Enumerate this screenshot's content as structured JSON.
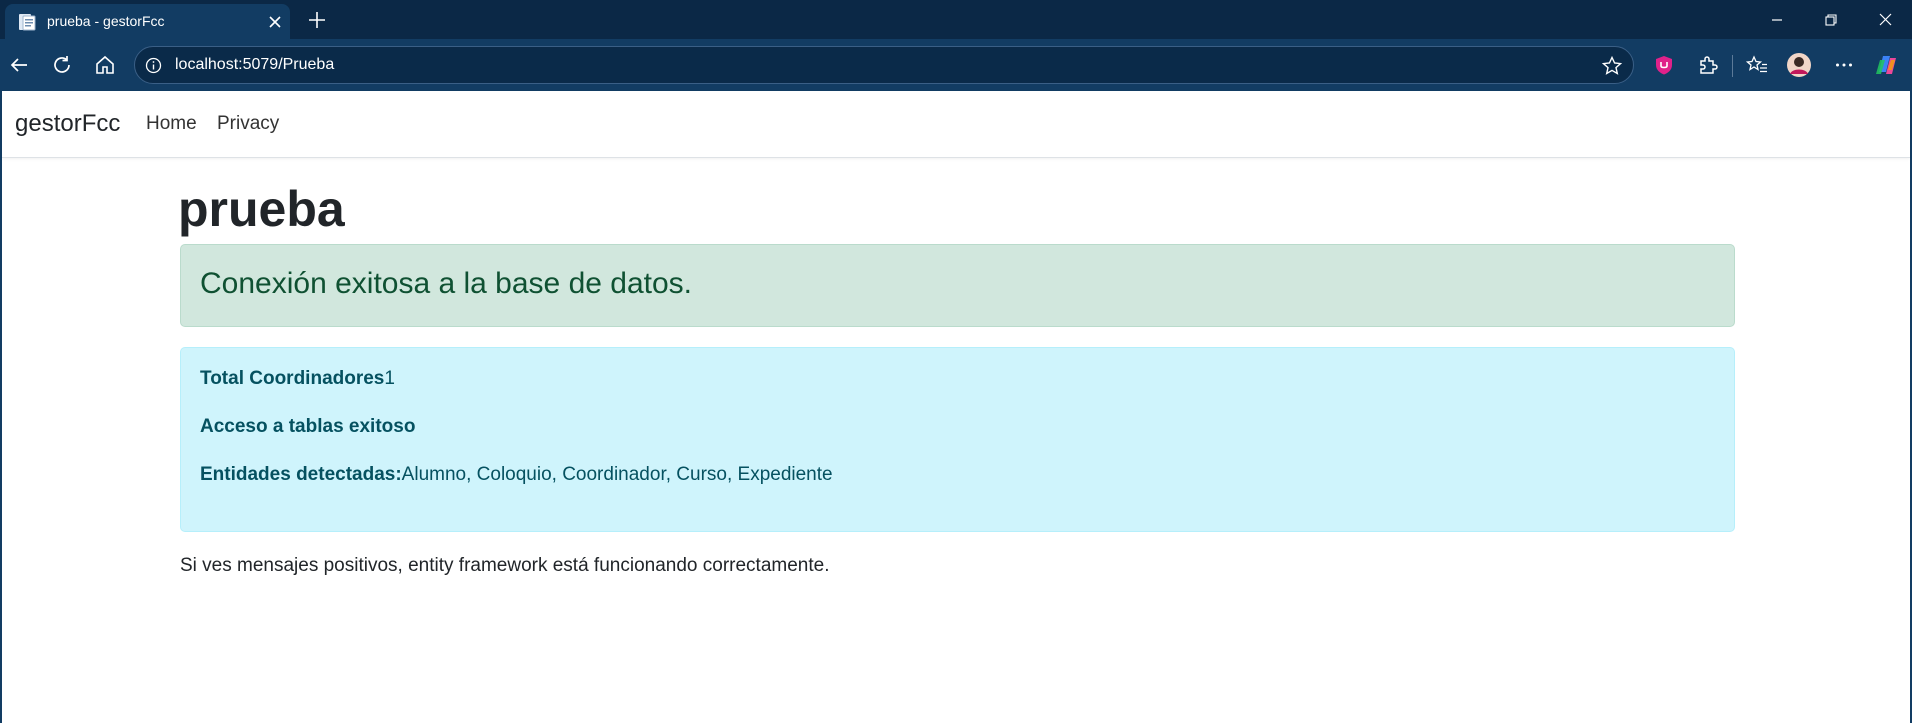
{
  "browser": {
    "tab_title": "prueba - gestorFcc",
    "url": "localhost:5079/Prueba"
  },
  "navbar": {
    "brand": "gestorFcc",
    "links": [
      "Home",
      "Privacy"
    ]
  },
  "page": {
    "title": "prueba",
    "success_message": "Conexión exitosa a la base de datos.",
    "info": {
      "coordinators_label": "Total Coordinadores",
      "coordinators_value": "1",
      "tables_access": "Acceso a tablas exitoso",
      "entities_label": "Entidades detectadas:",
      "entities_value": "Alumno, Coloquio, Coordinador, Curso, Expediente"
    },
    "footer_text": "Si ves mensajes positivos, entity framework está funcionando correctamente."
  },
  "colors": {
    "success_bg": "#d1e7dd",
    "success_text": "#0f5132",
    "info_bg": "#cff4fc",
    "info_text": "#055160",
    "chrome_dark": "#0b2846",
    "chrome_toolbar": "#123c63"
  }
}
